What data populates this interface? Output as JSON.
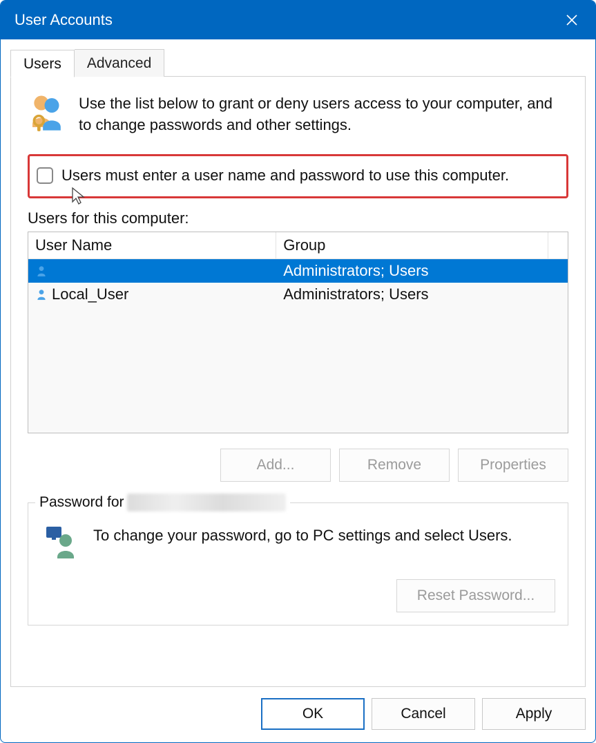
{
  "window": {
    "title": "User Accounts"
  },
  "tabs": {
    "users": "Users",
    "advanced": "Advanced"
  },
  "intro": "Use the list below to grant or deny users access to your computer, and to change passwords and other settings.",
  "checkbox_label": "Users must enter a user name and password to use this computer.",
  "list_label": "Users for this computer:",
  "columns": {
    "name": "User Name",
    "group": "Group"
  },
  "rows": [
    {
      "name": "",
      "group": "Administrators; Users",
      "selected": true
    },
    {
      "name": "Local_User",
      "group": "Administrators; Users",
      "selected": false
    }
  ],
  "buttons": {
    "add": "Add...",
    "remove": "Remove",
    "properties": "Properties"
  },
  "password_box": {
    "legend_prefix": "Password for",
    "text": "To change your password, go to PC settings and select Users.",
    "reset": "Reset Password..."
  },
  "bottom": {
    "ok": "OK",
    "cancel": "Cancel",
    "apply": "Apply"
  }
}
